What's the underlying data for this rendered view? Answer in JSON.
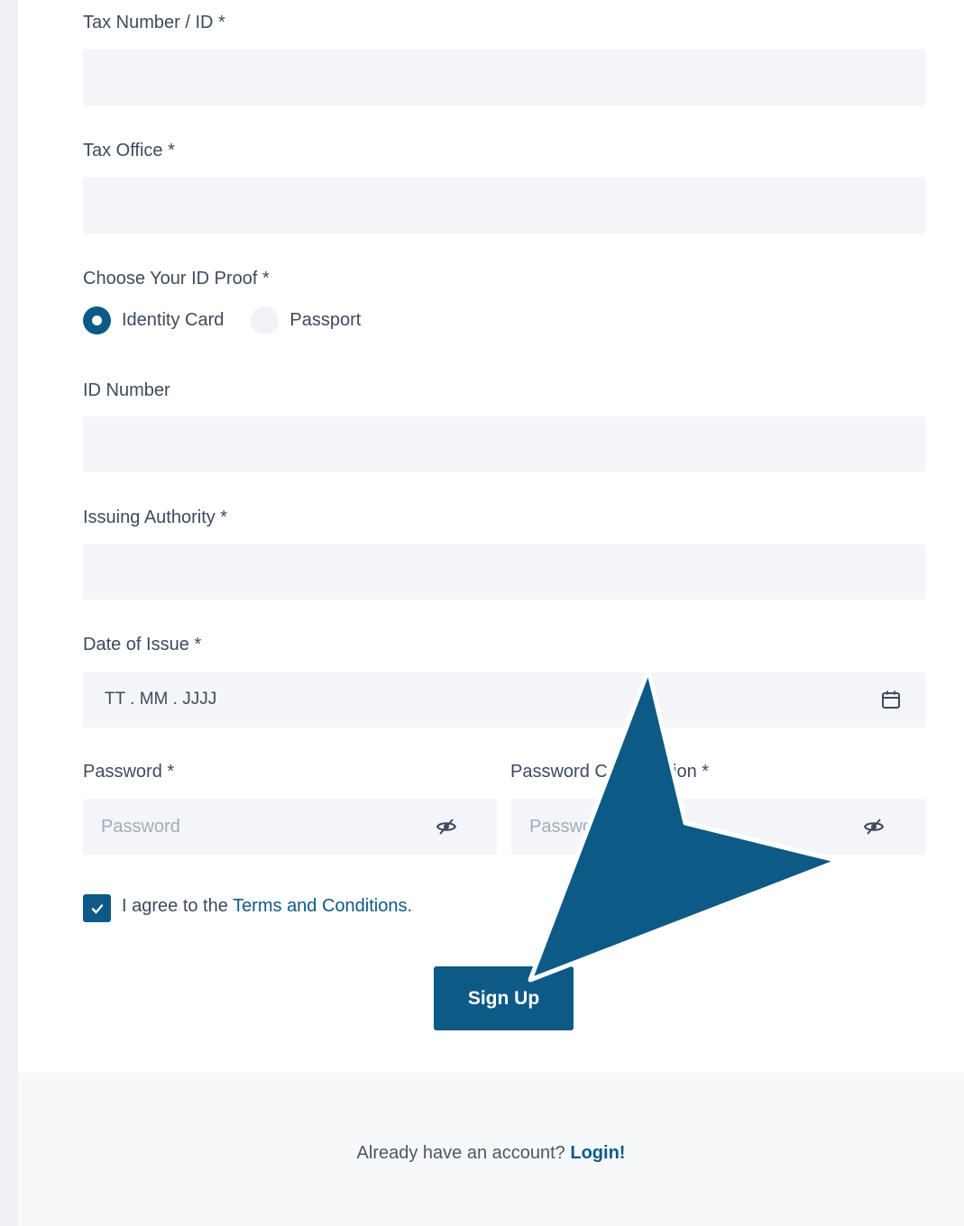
{
  "fields": {
    "tax_number": {
      "label": "Tax Number / ID *",
      "value": "",
      "placeholder": ""
    },
    "tax_office": {
      "label": "Tax Office *",
      "value": "",
      "placeholder": ""
    },
    "id_number": {
      "label": "ID Number",
      "value": "",
      "placeholder": ""
    },
    "issuing_authority": {
      "label": "Issuing Authority *",
      "value": "",
      "placeholder": ""
    },
    "date_of_issue": {
      "label": "Date of Issue *",
      "value": "TT . MM . JJJJ",
      "icon": "calendar-icon"
    },
    "password": {
      "label": "Password *",
      "placeholder": "Password",
      "icon": "eye-slash-icon"
    },
    "password_confirmation": {
      "label": "Password Confirmation *",
      "placeholder": "Password",
      "icon": "eye-slash-icon"
    }
  },
  "id_proof": {
    "label": "Choose Your ID Proof *",
    "options": [
      {
        "label": "Identity Card",
        "selected": true
      },
      {
        "label": "Passport",
        "selected": false
      }
    ]
  },
  "terms": {
    "checked": true,
    "prefix": "I agree to the ",
    "link": "Terms and Conditions."
  },
  "submit": {
    "label": "Sign Up"
  },
  "footer": {
    "text": "Already have an account? ",
    "link": "Login!"
  },
  "colors": {
    "primary": "#0d5a86",
    "input_bg": "#f3f5f9",
    "text": "#3d4a5c",
    "placeholder": "#a4acb8"
  }
}
